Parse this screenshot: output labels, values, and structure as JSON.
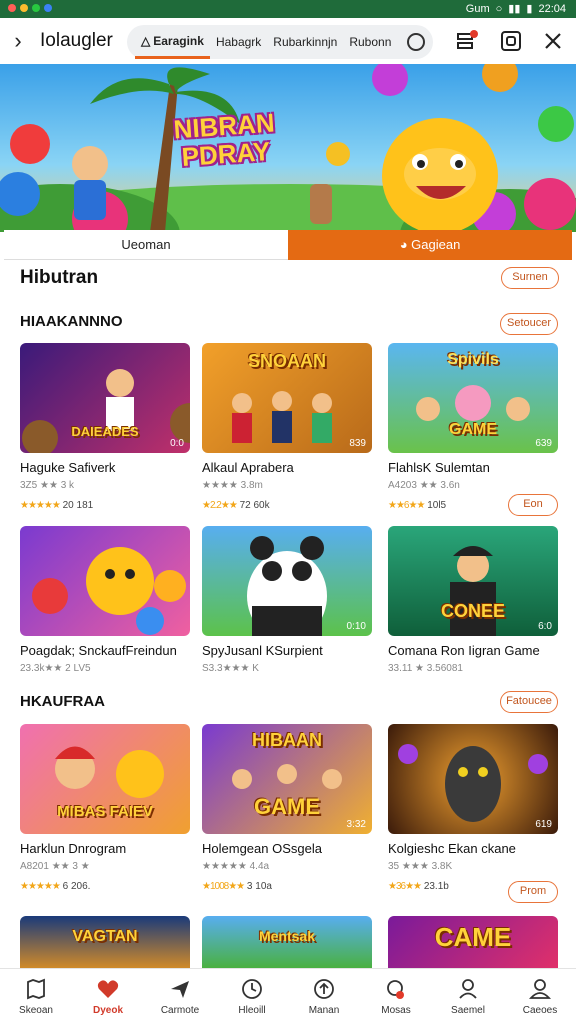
{
  "status_bar": {
    "carrier": "Gum",
    "time": "22:04"
  },
  "topbar": {
    "title": "Iolaugler"
  },
  "tabs": [
    {
      "label": "Earagink"
    },
    {
      "label": "Habagrk"
    },
    {
      "label": "Rubarkinnjn"
    },
    {
      "label": "Rubonn"
    }
  ],
  "hero": {
    "title_line1": "NIBRAN",
    "title_line2": "PDRAY"
  },
  "segments": {
    "left": "Ueoman",
    "right": "Gagiean"
  },
  "sections": {
    "hibutran": {
      "title": "Hibutran",
      "action": "Surnen"
    },
    "section1": {
      "title": "HIAAKANNNO",
      "action": "Setoucer"
    },
    "section2": {
      "title": "HKAUFRAA",
      "action": "Fatoucee"
    }
  },
  "games_row1": [
    {
      "name": "Haguke Safiverk",
      "meta": "3Z5 ★★ 3 k",
      "stars": "★★★★★",
      "rating": "20 181",
      "thumb_text": "DAIEADES",
      "badge": "0:0"
    },
    {
      "name": "Alkaul Aprabera",
      "meta": "★★★★ 3.8m",
      "stars": "★2.2★★",
      "rating": "72 60k",
      "thumb_text": "SNOAAN",
      "badge": "839"
    },
    {
      "name": "FlahlsK Sulemtan",
      "meta": "A4203 ★★ 3.6n",
      "stars": "★★6★★",
      "rating": "10l5",
      "thumb_text": "GAME",
      "badge": "639",
      "action": "Eon"
    }
  ],
  "games_row2": [
    {
      "name": "Poagdak; SnckaufFreindun",
      "meta": "23.3k★★ 2 LV5",
      "thumb_text": "",
      "badge": ""
    },
    {
      "name": "SpyJusanl KSurpient",
      "meta": "S3.3★★★ K",
      "thumb_text": "",
      "badge": "0:10"
    },
    {
      "name": "Comana Ron Iigran Game",
      "meta": "33.11 ★ 3.56081",
      "thumb_text": "CONEE",
      "badge": "6:0"
    }
  ],
  "games_row3": [
    {
      "name": "Harklun Dnrogram",
      "meta": "A8201 ★★ 3 ★",
      "stars": "★★★★★",
      "rating": "6 206.",
      "thumb_text": "MIBAS FAIEV",
      "badge": ""
    },
    {
      "name": "Holemgean OSsgela",
      "meta": "★★★★★ 4.4a",
      "stars": "★1008★★",
      "rating": "3 10a",
      "thumb_text": "GAME",
      "badge": "3:32"
    },
    {
      "name": "Kolgieshc Ekan ckane",
      "meta": "35 ★★★ 3.8K",
      "stars": "★36★★",
      "rating": "23.1b",
      "thumb_text": "",
      "badge": "619",
      "action": "Prom"
    }
  ],
  "games_row4": [
    {
      "thumb_text": "VAGTAN"
    },
    {
      "thumb_text": "Mentsak"
    },
    {
      "thumb_text": "CAME"
    }
  ],
  "bottom_nav": [
    {
      "label": "Skeoan",
      "icon": "map-icon"
    },
    {
      "label": "Dyeok",
      "icon": "heart-icon"
    },
    {
      "label": "Carmote",
      "icon": "send-icon"
    },
    {
      "label": "Hleoill",
      "icon": "clock-icon"
    },
    {
      "label": "Manan",
      "icon": "upload-icon"
    },
    {
      "label": "Mosas",
      "icon": "search-icon"
    },
    {
      "label": "Saemel",
      "icon": "user-icon"
    },
    {
      "label": "Caeoes",
      "icon": "person-icon"
    }
  ],
  "colors": {
    "accent": "#e8621c",
    "status_bar": "#1f6b3a",
    "active_nav": "#d13a2a"
  }
}
